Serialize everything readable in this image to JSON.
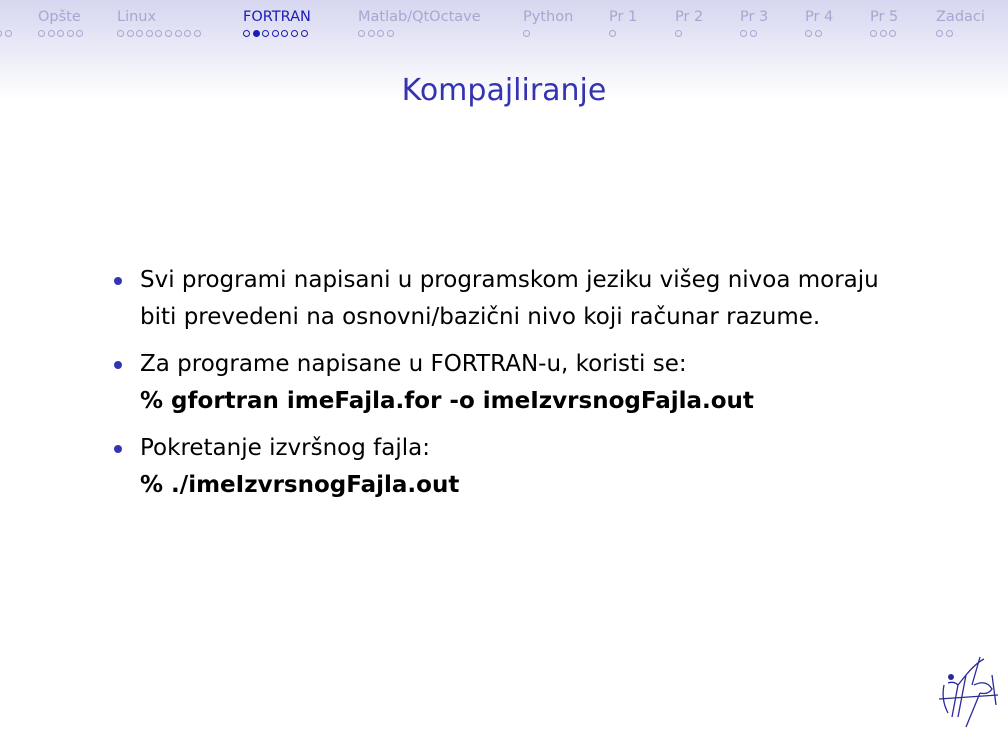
{
  "nav": {
    "sections": [
      {
        "label": "Opšte",
        "dots": 5,
        "filled": -1,
        "active": false
      },
      {
        "label": "Linux",
        "dots": 9,
        "filled": -1,
        "active": false
      },
      {
        "label": "FORTRAN",
        "dots": 7,
        "filled": 1,
        "active": true
      },
      {
        "label": "Matlab/QtOctave",
        "dots": 4,
        "filled": -1,
        "active": false
      },
      {
        "label": "Python",
        "dots": 1,
        "filled": -1,
        "active": false
      },
      {
        "label": "Pr 1",
        "dots": 1,
        "filled": -1,
        "active": false
      },
      {
        "label": "Pr 2",
        "dots": 1,
        "filled": -1,
        "active": false
      },
      {
        "label": "Pr 3",
        "dots": 2,
        "filled": -1,
        "active": false
      },
      {
        "label": "Pr 4",
        "dots": 2,
        "filled": -1,
        "active": false
      },
      {
        "label": "Pr 5",
        "dots": 3,
        "filled": -1,
        "active": false
      },
      {
        "label": "Zadaci",
        "dots": 2,
        "filled": -1,
        "active": false
      }
    ],
    "leading_dots": 2
  },
  "slide": {
    "title": "Kompajliranje",
    "bullets": [
      {
        "text": "Svi programi napisani u programskom jeziku višeg nivoa moraju biti prevedeni na osnovni/bazični nivo koji računar razume.",
        "command": ""
      },
      {
        "text": "Za programe napisane u FORTRAN-u, koristi se:",
        "command": "% gfortran imeFajla.for -o imeIzvrsnogFajla.out"
      },
      {
        "text": "Pokretanje izvršnog fajla:",
        "command": "% ./imeIzvrsnogFajla.out"
      }
    ]
  },
  "colors": {
    "title": "#3434b3",
    "nav_active": "#1b1bb5",
    "nav_inactive": "#a7a7d3",
    "bullet": "#3434b3"
  },
  "icons": {
    "logo": "university-logo-icon"
  }
}
